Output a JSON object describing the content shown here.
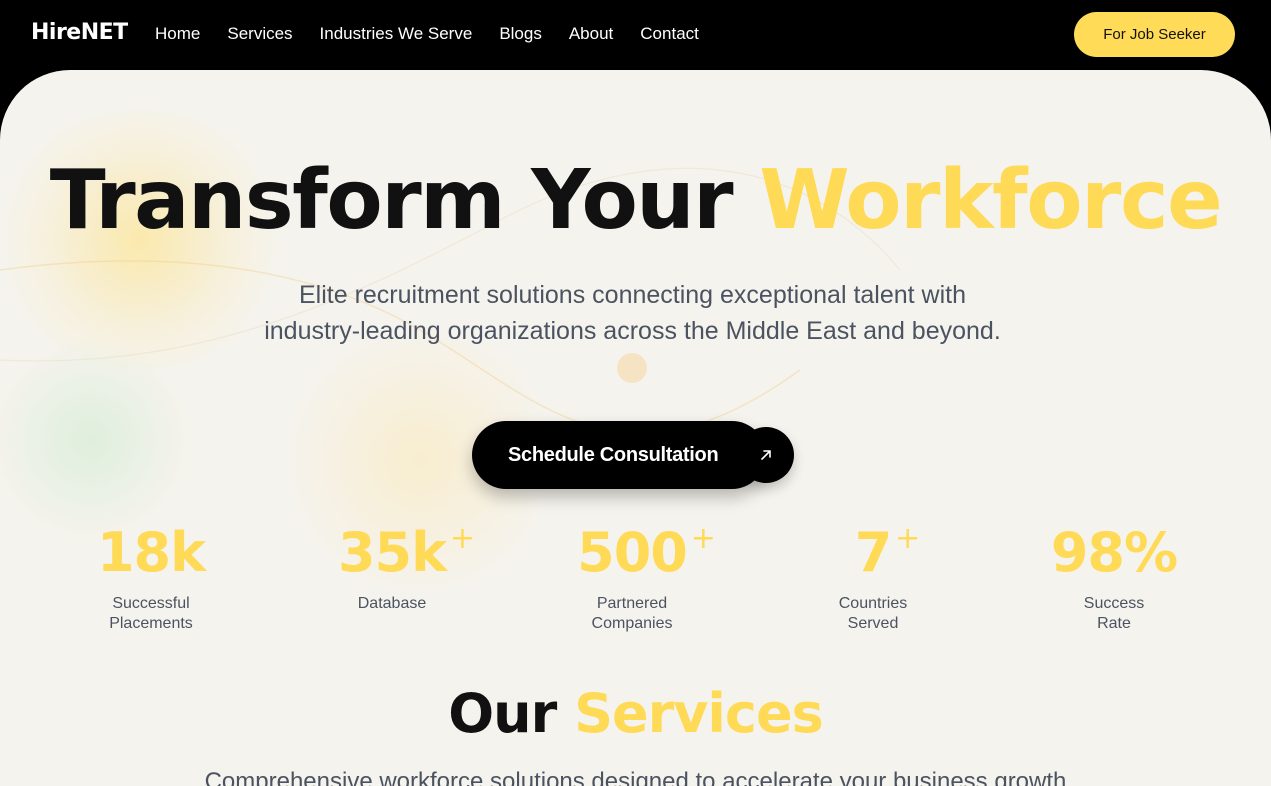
{
  "nav": {
    "logo": "HireNET",
    "links": [
      "Home",
      "Services",
      "Industries We Serve",
      "Blogs",
      "About",
      "Contact"
    ],
    "cta": "For Job Seeker"
  },
  "hero": {
    "title_main": "Transform Your",
    "title_accent": "Workforce",
    "subtitle_line1": "Elite recruitment solutions connecting exceptional talent with",
    "subtitle_line2": "industry-leading organizations across the Middle East and beyond.",
    "button_label": "Schedule Consultation",
    "button_icon": "arrow-up-right-icon"
  },
  "stats": [
    {
      "value": "18k",
      "plus": "",
      "label_line1": "Successful",
      "label_line2": "Placements"
    },
    {
      "value": "35k",
      "plus": "+",
      "label_line1": "Database",
      "label_line2": ""
    },
    {
      "value": "500",
      "plus": "+",
      "label_line1": "Partnered",
      "label_line2": "Companies"
    },
    {
      "value": "7",
      "plus": "+",
      "label_line1": "Countries",
      "label_line2": "Served"
    },
    {
      "value": "98%",
      "plus": "",
      "label_line1": "Success",
      "label_line2": "Rate"
    }
  ],
  "services": {
    "title_main": "Our",
    "title_accent": "Services",
    "subtitle": "Comprehensive workforce solutions designed to accelerate your business growth"
  },
  "colors": {
    "accent": "#ffda57",
    "background": "#f5f3ed",
    "nav_bg": "#000000",
    "text_dark": "#111111",
    "text_muted": "#4b5361"
  }
}
